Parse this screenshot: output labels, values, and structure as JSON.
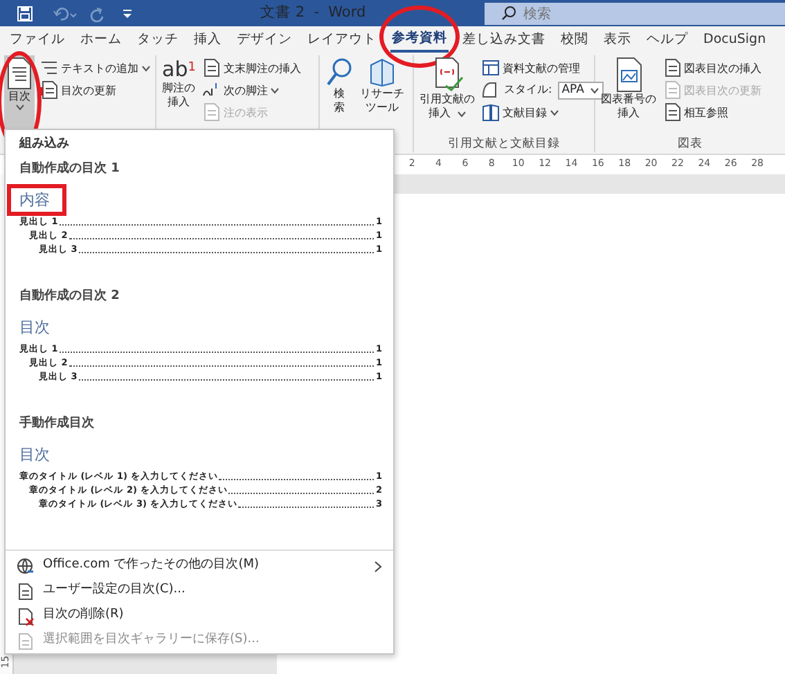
{
  "title_bar": {
    "title": "文書 2  -  Word",
    "search": {
      "placeholder": "検索"
    }
  },
  "tabs": [
    {
      "label": "ファイル",
      "selected": false
    },
    {
      "label": "ホーム",
      "selected": false
    },
    {
      "label": "タッチ",
      "selected": false
    },
    {
      "label": "挿入",
      "selected": false
    },
    {
      "label": "デザイン",
      "selected": false
    },
    {
      "label": "レイアウト",
      "selected": false
    },
    {
      "label": "参考資料",
      "selected": true,
      "circled": true
    },
    {
      "label": "差し込み文書",
      "selected": false
    },
    {
      "label": "校閲",
      "selected": false
    },
    {
      "label": "表示",
      "selected": false
    },
    {
      "label": "ヘルプ",
      "selected": false
    },
    {
      "label": "DocuSign",
      "selected": false
    }
  ],
  "ribbon": {
    "groups": [
      {
        "large": [
          {
            "label": [
              "目次"
            ],
            "dropdown": true,
            "pressed": true,
            "circled": true
          }
        ],
        "small": [
          {
            "kind": "button",
            "label": "テキストの追加",
            "dropdown": true,
            "disabled": false
          },
          {
            "kind": "button",
            "label": "目次の更新",
            "dropdown": false,
            "disabled": false
          }
        ]
      },
      {
        "large": [
          {
            "label": [
              "脚注の",
              "挿入"
            ],
            "glyph": "ab$^{1}$",
            "dropdown": false,
            "pressed": false
          }
        ],
        "small": [
          {
            "kind": "button",
            "label": "文末脚注の挿入",
            "dropdown": false,
            "disabled": false
          },
          {
            "kind": "button",
            "label": "次の脚注",
            "dropdown": true,
            "disabled": false
          },
          {
            "kind": "button",
            "label": "注の表示",
            "dropdown": false,
            "disabled": true
          }
        ]
      },
      {
        "large": [
          {
            "label": [
              "検",
              "索"
            ],
            "dropdown": false,
            "pressed": false
          },
          {
            "label": [
              "リサーチ",
              "ツール"
            ],
            "dropdown": false,
            "pressed": false
          }
        ]
      },
      {
        "label": "引用文献と文献目録",
        "large": [
          {
            "label": [
              "引用文献の",
              "挿入"
            ],
            "dropdown": true,
            "pressed": false
          }
        ],
        "small": [
          {
            "kind": "button",
            "label": "資料文献の管理",
            "dropdown": false,
            "disabled": false
          },
          {
            "kind": "select",
            "label": "スタイル:",
            "value": "APA"
          },
          {
            "kind": "button",
            "label": "文献目録",
            "dropdown": true,
            "disabled": false
          }
        ]
      },
      {
        "label": "図表",
        "large": [
          {
            "label": [
              "図表番号の",
              "挿入"
            ],
            "dropdown": false,
            "pressed": false
          }
        ],
        "small": [
          {
            "kind": "button",
            "label": "図表目次の挿入",
            "dropdown": false,
            "disabled": false
          },
          {
            "kind": "button",
            "label": "図表目次の更新",
            "dropdown": false,
            "disabled": true
          },
          {
            "kind": "button",
            "label": "相互参照",
            "dropdown": false,
            "disabled": false
          }
        ]
      }
    ]
  },
  "ruler": {
    "numbers": [
      "2",
      "4",
      "6",
      "8",
      "10",
      "12",
      "14",
      "16",
      "18",
      "20",
      "22",
      "24",
      "26",
      "28"
    ]
  },
  "vertical_ruler": {
    "numbers": [
      "15"
    ]
  },
  "toc_menu": {
    "heading": "組み込み",
    "gallery": [
      {
        "name": "自動作成の目次 1",
        "preview": {
          "title": "内容",
          "boxed": true,
          "entries": [
            {
              "text": "見出し 1",
              "page": "1",
              "children": [
                {
                  "text": "見出し 2",
                  "page": "1",
                  "children": [
                    {
                      "text": "見出し 3",
                      "page": "1"
                    }
                  ]
                }
              ]
            }
          ]
        }
      },
      {
        "name": "自動作成の目次 2",
        "preview": {
          "title": "目次",
          "entries": [
            {
              "text": "見出し 1",
              "page": "1",
              "children": [
                {
                  "text": "見出し 2",
                  "page": "1",
                  "children": [
                    {
                      "text": "見出し 3",
                      "page": "1"
                    }
                  ]
                }
              ]
            }
          ]
        }
      },
      {
        "name": "手動作成目次",
        "preview": {
          "title": "目次",
          "entries": [
            {
              "text": "章のタイトル (レベル 1) を入力してください",
              "page": "1",
              "children": [
                {
                  "text": "章のタイトル (レベル 2) を入力してください",
                  "page": "2",
                  "children": [
                    {
                      "text": "章のタイトル (レベル 3) を入力してください",
                      "page": "3"
                    }
                  ]
                }
              ]
            }
          ]
        }
      }
    ],
    "commands": [
      {
        "label": "Office.com で作ったその他の目次(M)",
        "submenu": true,
        "disabled": false
      },
      {
        "label": "ユーザー設定の目次(C)...",
        "submenu": false,
        "disabled": false
      },
      {
        "label": "目次の削除(R)",
        "submenu": false,
        "disabled": false
      },
      {
        "label": "選択範囲を目次ギャラリーに保存(S)...",
        "submenu": false,
        "disabled": true
      }
    ]
  }
}
